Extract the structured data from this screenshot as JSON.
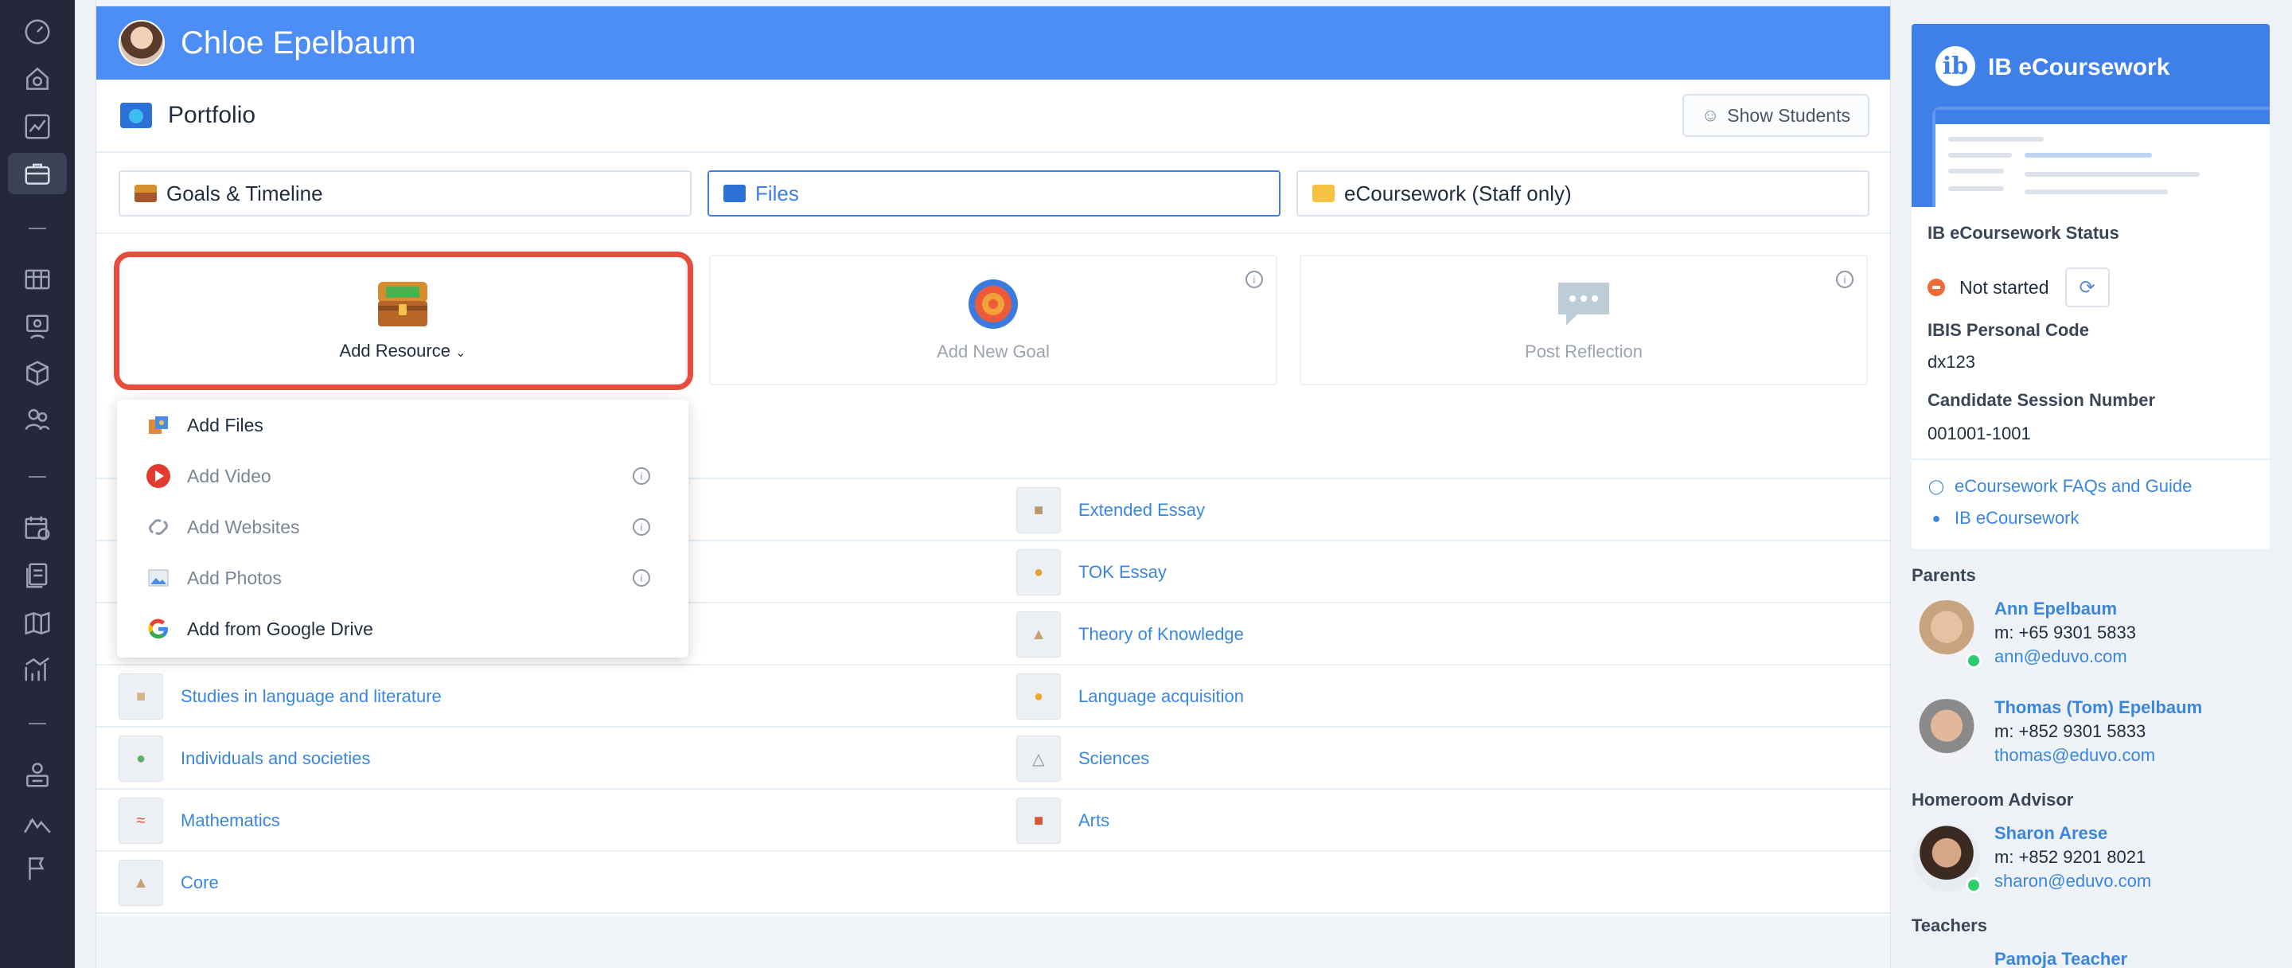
{
  "header": {
    "student_name": "Chloe Epelbaum"
  },
  "portfolio": {
    "title": "Portfolio",
    "show_students_label": "Show Students"
  },
  "tabs": [
    {
      "label": "Goals & Timeline",
      "selected": false
    },
    {
      "label": "Files",
      "selected": true
    },
    {
      "label": "eCoursework (Staff only)",
      "selected": false
    }
  ],
  "actions": {
    "add_resource": "Add Resource",
    "add_new_goal": "Add New Goal",
    "post_reflection": "Post Reflection"
  },
  "dropdown": {
    "items": [
      {
        "label": "Add Files",
        "icon": "files-icon",
        "info": false,
        "muted": false
      },
      {
        "label": "Add Video",
        "icon": "video-play-icon",
        "info": true,
        "muted": true
      },
      {
        "label": "Add Websites",
        "icon": "link-icon",
        "info": true,
        "muted": true
      },
      {
        "label": "Add Photos",
        "icon": "photo-icon",
        "info": true,
        "muted": true
      },
      {
        "label": "Add from Google Drive",
        "icon": "google-drive-icon",
        "info": false,
        "muted": false
      }
    ]
  },
  "folders": {
    "left": [
      "Studies in language and literature",
      "Individuals and societies",
      "Mathematics",
      "Core"
    ],
    "right": [
      "Extended Essay",
      "TOK Essay",
      "Theory of Knowledge",
      "Language acquisition",
      "Sciences",
      "Arts"
    ]
  },
  "ib": {
    "title": "IB eCoursework",
    "status_label": "IB eCoursework Status",
    "status_value": "Not started",
    "ibis_label": "IBIS Personal Code",
    "ibis_value": "dx123",
    "session_label": "Candidate Session Number",
    "session_value": "001001-1001",
    "faq_link": "eCoursework FAQs and Guide",
    "ib_link": "IB eCoursework"
  },
  "parents": {
    "heading": "Parents",
    "people": [
      {
        "name": "Ann Epelbaum",
        "phone": "m: +65 9301 5833",
        "email": "ann@eduvo.com",
        "online": true
      },
      {
        "name": "Thomas (Tom) Epelbaum",
        "phone": "m: +852 9301 5833",
        "email": "thomas@eduvo.com",
        "online": false
      }
    ]
  },
  "homeroom": {
    "heading": "Homeroom Advisor",
    "name": "Sharon Arese",
    "phone": "m: +852 9201 8021",
    "email": "sharon@eduvo.com"
  },
  "teachers": {
    "heading": "Teachers",
    "first_name": "Pamoja Teacher"
  },
  "colors": {
    "accent": "#4c8df6",
    "highlight": "#e84c3d",
    "link": "#3a86dd",
    "rail": "#24283a"
  }
}
